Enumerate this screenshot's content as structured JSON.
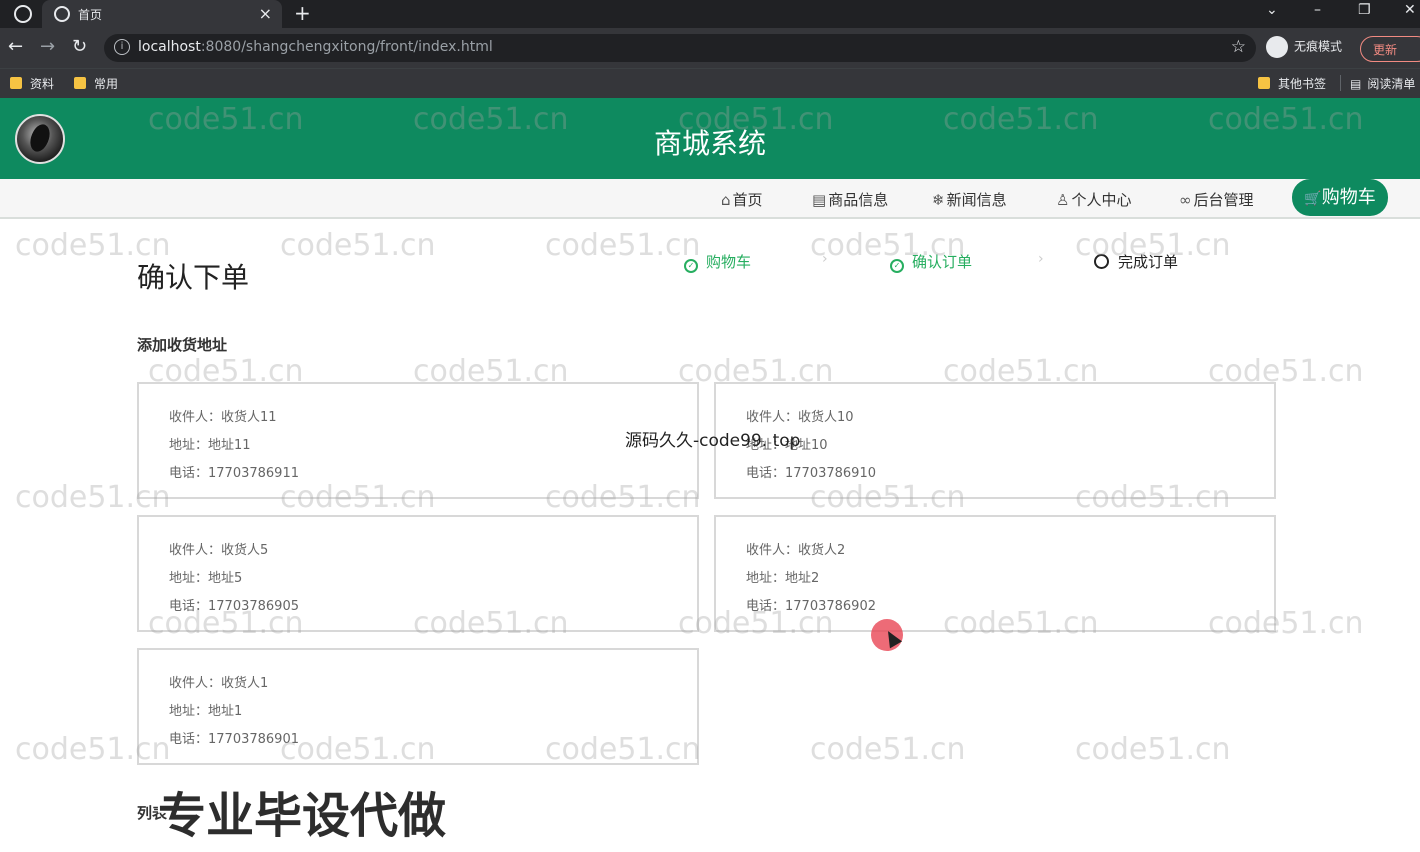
{
  "browser": {
    "tab_title": "首页",
    "tab_close": "×",
    "new_tab": "+",
    "url_host": "localhost",
    "url_rest": ":8080/shangchengxitong/front/index.html",
    "incognito_label": "无痕模式",
    "update_label": "更新",
    "bookmarks": [
      "资料",
      "常用",
      "其他书签",
      "阅读清单"
    ],
    "window_controls": [
      "⌄",
      "–",
      "❐",
      "✕"
    ]
  },
  "site": {
    "title": "商城系统",
    "nav": [
      "首页",
      "商品信息",
      "新闻信息",
      "个人中心",
      "后台管理"
    ],
    "cart": "购物车"
  },
  "page": {
    "title": "确认下单",
    "steps": [
      "购物车",
      "确认订单",
      "完成订单"
    ],
    "address_section": "添加收货地址",
    "list_section": "列表"
  },
  "addresses": [
    {
      "name": "收件人：收货人11",
      "addr": "地址：地址11",
      "phone": "电话：17703786911"
    },
    {
      "name": "收件人：收货人10",
      "addr": "地址：地址10",
      "phone": "电话：17703786910"
    },
    {
      "name": "收件人：收货人5",
      "addr": "地址：地址5",
      "phone": "电话：17703786905"
    },
    {
      "name": "收件人：收货人2",
      "addr": "地址：地址2",
      "phone": "电话：17703786902"
    },
    {
      "name": "收件人：收货人1",
      "addr": "地址：地址1",
      "phone": "电话：17703786901"
    }
  ],
  "overlays": {
    "watermark": "code51.cn",
    "source_text": "源码久久-code99. top",
    "promo": "专业毕设代做"
  },
  "colors": {
    "brand_green": "#0e8a5f",
    "step_done": "#27ae60"
  }
}
